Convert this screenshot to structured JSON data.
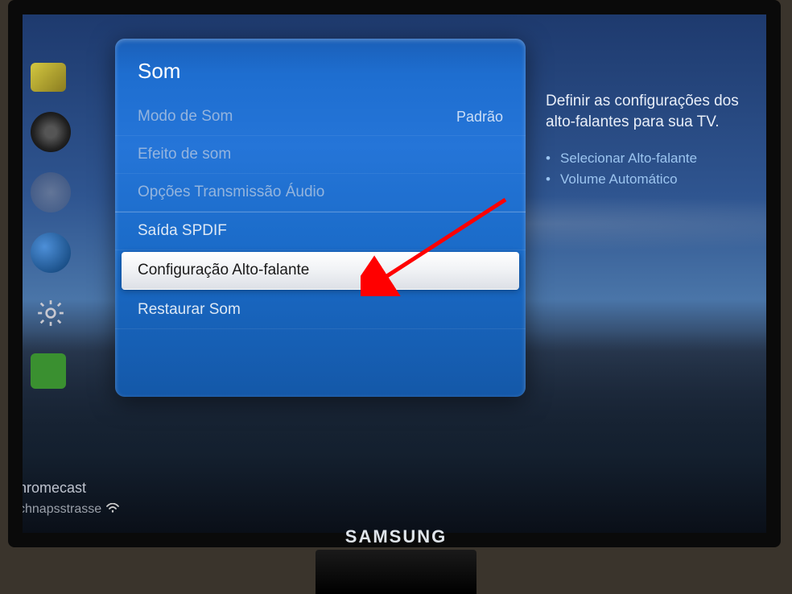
{
  "menu": {
    "title": "Som",
    "items": [
      {
        "label": "Modo de Som",
        "value": "Padrão",
        "disabled": true,
        "selected": false
      },
      {
        "label": "Efeito de som",
        "value": "",
        "disabled": true,
        "selected": false
      },
      {
        "label": "Opções Transmissão Áudio",
        "value": "",
        "disabled": true,
        "selected": false
      },
      {
        "label": "Saída SPDIF",
        "value": "",
        "disabled": false,
        "selected": false,
        "sectionStart": true
      },
      {
        "label": "Configuração Alto-falante",
        "value": "",
        "disabled": false,
        "selected": true
      },
      {
        "label": "Restaurar Som",
        "value": "",
        "disabled": false,
        "selected": false
      }
    ]
  },
  "help": {
    "title": "Definir as configurações dos alto-falantes para sua TV.",
    "bullets": [
      "Selecionar Alto-falante",
      "Volume Automático"
    ]
  },
  "sidebar": {
    "icons": [
      "picture",
      "speaker",
      "broadcast",
      "globe",
      "gear",
      "puzzle"
    ]
  },
  "overlay": {
    "line1": "hromecast",
    "line2": "chnapsstrasse"
  },
  "brand": "SAMSUNG"
}
